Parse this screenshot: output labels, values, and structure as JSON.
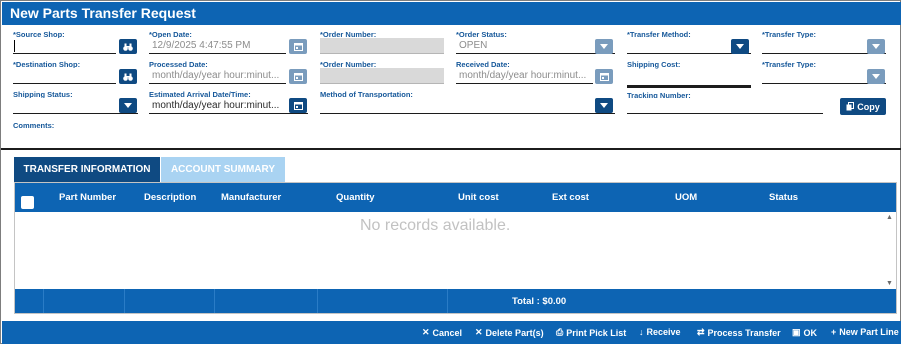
{
  "title": "New Parts Transfer Request",
  "form": {
    "source_shop_label": "*Source Shop:",
    "open_date_label": "*Open Date:",
    "open_date_value": "12/9/2025 4:47:55 PM",
    "order_number_label_1": "*Order Number:",
    "order_status_label": "*Order Status:",
    "order_status_value": "OPEN",
    "transfer_method_label": "*Transfer Method:",
    "transfer_type_label_1": "*Transfer Type:",
    "destination_shop_label": "*Destination Shop:",
    "processed_date_label": "Processed Date:",
    "processed_date_placeholder": "month/day/year hour:minut...",
    "order_number_label_2": "*Order Number:",
    "received_date_label": "Received Date:",
    "received_date_placeholder": "month/day/year hour:minut...",
    "shipping_cost_label": "Shipping Cost:",
    "transfer_type_label_2": "*Transfer Type:",
    "shipping_status_label": "Shipping Status:",
    "eta_label": "Estimated Arrival Date/Time:",
    "eta_placeholder": "month/day/year hour:minut...",
    "method_of_transportation_label": "Method of Transportation:",
    "tracking_number_label": "Tracking Number:",
    "copy_label": "Copy",
    "comments_label": "Comments:"
  },
  "tabs": [
    {
      "label": "TRANSFER INFORMATION",
      "active": true
    },
    {
      "label": "ACCOUNT SUMMARY",
      "active": false
    }
  ],
  "grid": {
    "columns": [
      "Part Number",
      "Description",
      "Manufacturer",
      "Quantity",
      "Unit cost",
      "Ext cost",
      "UOM",
      "Status"
    ],
    "empty_message": "No records available.",
    "total": "Total : $0.00"
  },
  "actions": {
    "cancel": "Cancel",
    "delete_parts": "Delete Part(s)",
    "print_pick_list": "Print Pick List",
    "receive": "Receive",
    "process_transfer": "Process Transfer",
    "ok": "OK",
    "new_part_line": "New Part Line"
  },
  "colors": {
    "primary": "#0d64b3",
    "dark_button": "#0f4a82",
    "label": "#16589a",
    "inactive_tab": "#a9d3f2"
  },
  "icons": {
    "binoculars": "binoculars-icon",
    "calendar": "calendar-icon",
    "dropdown": "chevron-down-icon",
    "copy": "copy-icon"
  }
}
